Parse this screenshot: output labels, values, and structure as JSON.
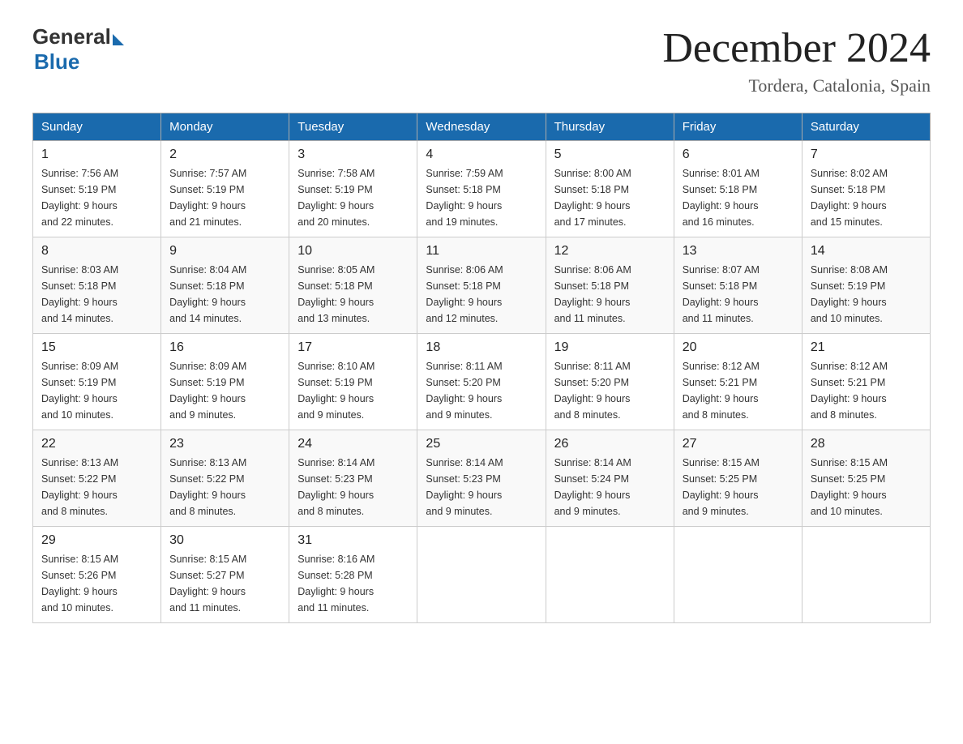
{
  "logo": {
    "general": "General",
    "blue": "Blue"
  },
  "title": {
    "month": "December 2024",
    "location": "Tordera, Catalonia, Spain"
  },
  "weekdays": [
    "Sunday",
    "Monday",
    "Tuesday",
    "Wednesday",
    "Thursday",
    "Friday",
    "Saturday"
  ],
  "weeks": [
    [
      {
        "day": "1",
        "sunrise": "7:56 AM",
        "sunset": "5:19 PM",
        "daylight": "9 hours and 22 minutes."
      },
      {
        "day": "2",
        "sunrise": "7:57 AM",
        "sunset": "5:19 PM",
        "daylight": "9 hours and 21 minutes."
      },
      {
        "day": "3",
        "sunrise": "7:58 AM",
        "sunset": "5:19 PM",
        "daylight": "9 hours and 20 minutes."
      },
      {
        "day": "4",
        "sunrise": "7:59 AM",
        "sunset": "5:18 PM",
        "daylight": "9 hours and 19 minutes."
      },
      {
        "day": "5",
        "sunrise": "8:00 AM",
        "sunset": "5:18 PM",
        "daylight": "9 hours and 17 minutes."
      },
      {
        "day": "6",
        "sunrise": "8:01 AM",
        "sunset": "5:18 PM",
        "daylight": "9 hours and 16 minutes."
      },
      {
        "day": "7",
        "sunrise": "8:02 AM",
        "sunset": "5:18 PM",
        "daylight": "9 hours and 15 minutes."
      }
    ],
    [
      {
        "day": "8",
        "sunrise": "8:03 AM",
        "sunset": "5:18 PM",
        "daylight": "9 hours and 14 minutes."
      },
      {
        "day": "9",
        "sunrise": "8:04 AM",
        "sunset": "5:18 PM",
        "daylight": "9 hours and 14 minutes."
      },
      {
        "day": "10",
        "sunrise": "8:05 AM",
        "sunset": "5:18 PM",
        "daylight": "9 hours and 13 minutes."
      },
      {
        "day": "11",
        "sunrise": "8:06 AM",
        "sunset": "5:18 PM",
        "daylight": "9 hours and 12 minutes."
      },
      {
        "day": "12",
        "sunrise": "8:06 AM",
        "sunset": "5:18 PM",
        "daylight": "9 hours and 11 minutes."
      },
      {
        "day": "13",
        "sunrise": "8:07 AM",
        "sunset": "5:18 PM",
        "daylight": "9 hours and 11 minutes."
      },
      {
        "day": "14",
        "sunrise": "8:08 AM",
        "sunset": "5:19 PM",
        "daylight": "9 hours and 10 minutes."
      }
    ],
    [
      {
        "day": "15",
        "sunrise": "8:09 AM",
        "sunset": "5:19 PM",
        "daylight": "9 hours and 10 minutes."
      },
      {
        "day": "16",
        "sunrise": "8:09 AM",
        "sunset": "5:19 PM",
        "daylight": "9 hours and 9 minutes."
      },
      {
        "day": "17",
        "sunrise": "8:10 AM",
        "sunset": "5:19 PM",
        "daylight": "9 hours and 9 minutes."
      },
      {
        "day": "18",
        "sunrise": "8:11 AM",
        "sunset": "5:20 PM",
        "daylight": "9 hours and 9 minutes."
      },
      {
        "day": "19",
        "sunrise": "8:11 AM",
        "sunset": "5:20 PM",
        "daylight": "9 hours and 8 minutes."
      },
      {
        "day": "20",
        "sunrise": "8:12 AM",
        "sunset": "5:21 PM",
        "daylight": "9 hours and 8 minutes."
      },
      {
        "day": "21",
        "sunrise": "8:12 AM",
        "sunset": "5:21 PM",
        "daylight": "9 hours and 8 minutes."
      }
    ],
    [
      {
        "day": "22",
        "sunrise": "8:13 AM",
        "sunset": "5:22 PM",
        "daylight": "9 hours and 8 minutes."
      },
      {
        "day": "23",
        "sunrise": "8:13 AM",
        "sunset": "5:22 PM",
        "daylight": "9 hours and 8 minutes."
      },
      {
        "day": "24",
        "sunrise": "8:14 AM",
        "sunset": "5:23 PM",
        "daylight": "9 hours and 8 minutes."
      },
      {
        "day": "25",
        "sunrise": "8:14 AM",
        "sunset": "5:23 PM",
        "daylight": "9 hours and 9 minutes."
      },
      {
        "day": "26",
        "sunrise": "8:14 AM",
        "sunset": "5:24 PM",
        "daylight": "9 hours and 9 minutes."
      },
      {
        "day": "27",
        "sunrise": "8:15 AM",
        "sunset": "5:25 PM",
        "daylight": "9 hours and 9 minutes."
      },
      {
        "day": "28",
        "sunrise": "8:15 AM",
        "sunset": "5:25 PM",
        "daylight": "9 hours and 10 minutes."
      }
    ],
    [
      {
        "day": "29",
        "sunrise": "8:15 AM",
        "sunset": "5:26 PM",
        "daylight": "9 hours and 10 minutes."
      },
      {
        "day": "30",
        "sunrise": "8:15 AM",
        "sunset": "5:27 PM",
        "daylight": "9 hours and 11 minutes."
      },
      {
        "day": "31",
        "sunrise": "8:16 AM",
        "sunset": "5:28 PM",
        "daylight": "9 hours and 11 minutes."
      },
      null,
      null,
      null,
      null
    ]
  ]
}
